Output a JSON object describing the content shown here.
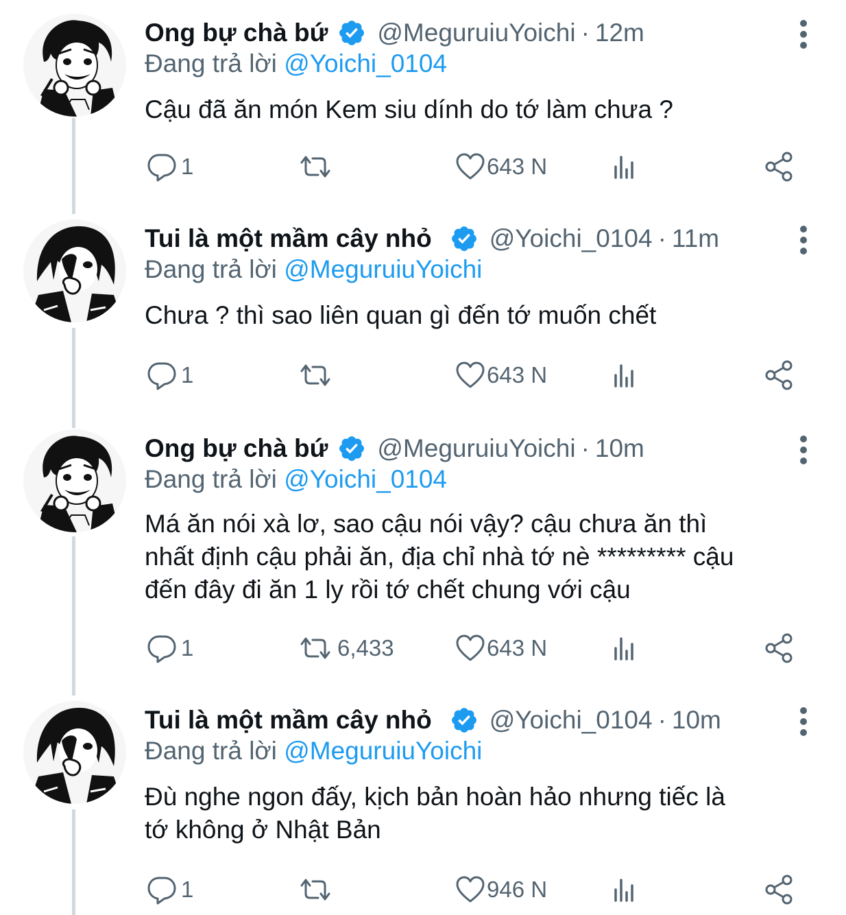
{
  "colors": {
    "accent": "#1d9bf0",
    "muted": "#536471",
    "text": "#0f1419",
    "thread_line": "#cfd9de"
  },
  "tweets": [
    {
      "display_name": "Ong bự chà bứ",
      "handle": "@MeguruiuYoichi",
      "separator": "·",
      "time": "12m",
      "reply_prefix": "Đang trả lời",
      "reply_to": "@Yoichi_0104",
      "text_lines": [
        "Cậu đã ăn món Kem siu dính do tớ làm chưa ?"
      ],
      "replies": "1",
      "retweets": "",
      "likes": "643 N",
      "avatar": "avatar-headphones-boy"
    },
    {
      "display_name": "Tui là một mầm cây nhỏ",
      "handle": "@Yoichi_0104",
      "separator": "·",
      "time": "11m",
      "reply_prefix": "Đang trả lời",
      "reply_to": "@MeguruiuYoichi",
      "text_lines": [
        "Chưa ? thì sao liên quan gì đến tớ muốn chết"
      ],
      "replies": "1",
      "retweets": "",
      "likes": "643 N",
      "avatar": "avatar-dark-hair-boy"
    },
    {
      "display_name": "Ong bự chà bứ",
      "handle": "@MeguruiuYoichi",
      "separator": "·",
      "time": "10m",
      "reply_prefix": "Đang trả lời",
      "reply_to": "@Yoichi_0104",
      "text_lines": [
        "Má ăn nói xà lơ, sao cậu nói vậy? cậu chưa ăn thì",
        "nhất định cậu phải ăn, địa chỉ nhà tớ nè ********* cậu",
        "đến đây đi ăn 1 ly rồi tớ chết chung với cậu"
      ],
      "replies": "1",
      "retweets": "6,433",
      "likes": "643 N",
      "avatar": "avatar-headphones-boy"
    },
    {
      "display_name": "Tui là một mầm cây nhỏ",
      "handle": "@Yoichi_0104",
      "separator": "·",
      "time": "10m",
      "reply_prefix": "Đang trả lời",
      "reply_to": "@MeguruiuYoichi",
      "text_lines": [
        "Đù nghe ngon đấy, kịch bản hoàn hảo nhưng tiếc là",
        "tớ không ở Nhật Bản"
      ],
      "replies": "1",
      "retweets": "",
      "likes": "946 N",
      "avatar": "avatar-dark-hair-boy"
    }
  ]
}
